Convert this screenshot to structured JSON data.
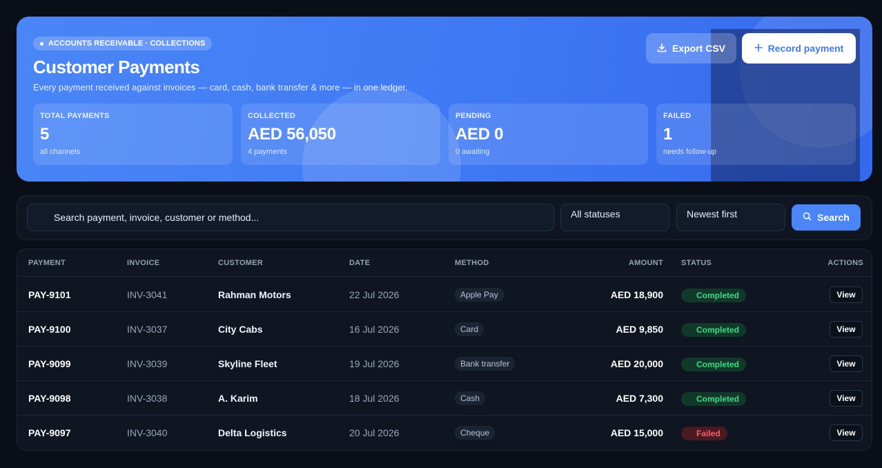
{
  "header": {
    "eyebrow": "ACCOUNTS RECEIVABLE · COLLECTIONS",
    "title": "Customer Payments",
    "subtitle": "Every payment received against invoices — card, cash, bank transfer & more — in one ledger.",
    "export_label": "Export CSV",
    "record_label": "Record payment"
  },
  "stats": [
    {
      "label": "TOTAL PAYMENTS",
      "value": "5",
      "sub": "all channels"
    },
    {
      "label": "COLLECTED",
      "value": "AED 56,050",
      "sub": "4 payments"
    },
    {
      "label": "PENDING",
      "value": "AED 0",
      "sub": "0 awaiting"
    },
    {
      "label": "FAILED",
      "value": "1",
      "sub": "needs follow-up"
    }
  ],
  "filters": {
    "search_placeholder": "Search payment, invoice, customer or method...",
    "status_value": "All statuses",
    "sort_value": "Newest first",
    "search_button": "Search"
  },
  "table": {
    "columns": [
      "PAYMENT",
      "INVOICE",
      "CUSTOMER",
      "DATE",
      "METHOD",
      "AMOUNT",
      "STATUS",
      "ACTIONS"
    ],
    "rows": [
      {
        "payment": "PAY-9101",
        "invoice": "INV-3041",
        "customer": "Rahman Motors",
        "date": "22 Jul 2026",
        "method": "Apple Pay",
        "amount": "AED 18,900",
        "status": "Completed",
        "action": "View"
      },
      {
        "payment": "PAY-9100",
        "invoice": "INV-3037",
        "customer": "City Cabs",
        "date": "16 Jul 2026",
        "method": "Card",
        "amount": "AED 9,850",
        "status": "Completed",
        "action": "View"
      },
      {
        "payment": "PAY-9099",
        "invoice": "INV-3039",
        "customer": "Skyline Fleet",
        "date": "19 Jul 2026",
        "method": "Bank transfer",
        "amount": "AED 20,000",
        "status": "Completed",
        "action": "View"
      },
      {
        "payment": "PAY-9098",
        "invoice": "INV-3038",
        "customer": "A. Karim",
        "date": "18 Jul 2026",
        "method": "Cash",
        "amount": "AED 7,300",
        "status": "Completed",
        "action": "View"
      },
      {
        "payment": "PAY-9097",
        "invoice": "INV-3040",
        "customer": "Delta Logistics",
        "date": "20 Jul 2026",
        "method": "Cheque",
        "amount": "AED 15,000",
        "status": "Failed",
        "action": "View"
      }
    ]
  },
  "colors": {
    "accent": "#4a86f7",
    "completed": "#3ddc84",
    "failed": "#ff5c6a",
    "background": "#0a0e16"
  },
  "icons": {
    "export": "download-icon",
    "record": "plus-icon",
    "search": "search-icon"
  }
}
